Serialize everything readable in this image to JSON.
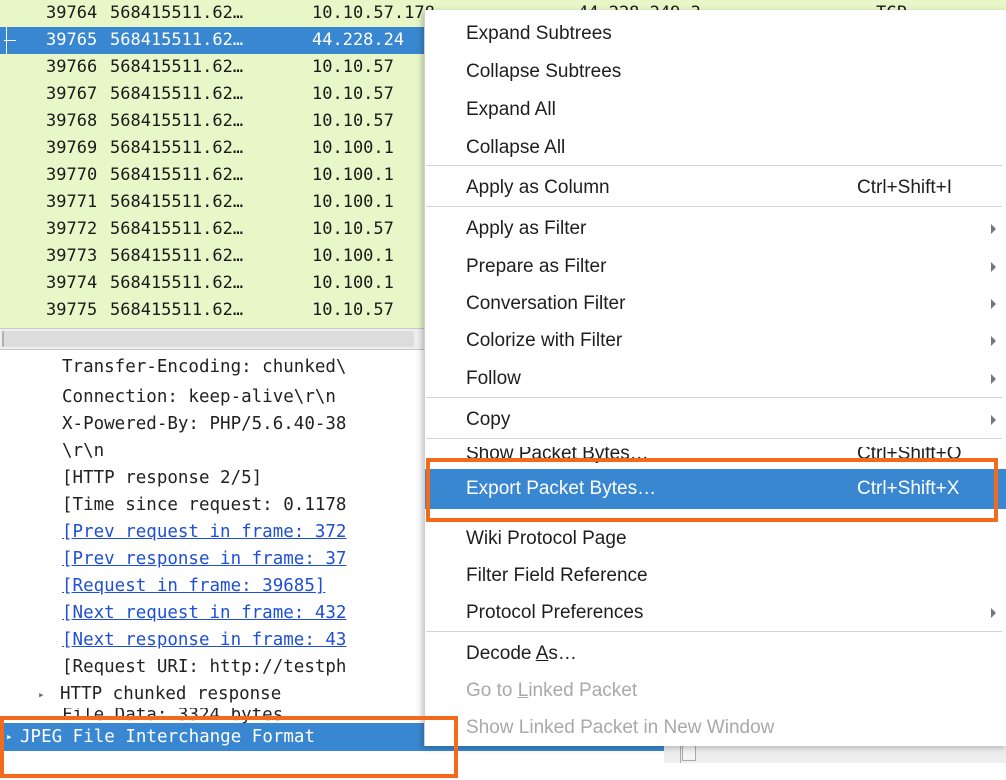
{
  "packet_list": {
    "rows": [
      {
        "no": "39764",
        "time": "568415511.62…",
        "src": "10.10.57.178",
        "dst": "44.228.249.3",
        "proto": "TCP",
        "selected": false
      },
      {
        "no": "39765",
        "time": "568415511.62…",
        "src": "44.228.24",
        "dst": "",
        "proto": "",
        "selected": true
      },
      {
        "no": "39766",
        "time": "568415511.62…",
        "src": "10.10.57",
        "dst": "",
        "proto": "",
        "selected": false
      },
      {
        "no": "39767",
        "time": "568415511.62…",
        "src": "10.10.57",
        "dst": "",
        "proto": "",
        "selected": false
      },
      {
        "no": "39768",
        "time": "568415511.62…",
        "src": "10.10.57",
        "dst": "",
        "proto": "",
        "selected": false
      },
      {
        "no": "39769",
        "time": "568415511.62…",
        "src": "10.100.1",
        "dst": "",
        "proto": "",
        "selected": false
      },
      {
        "no": "39770",
        "time": "568415511.62…",
        "src": "10.100.1",
        "dst": "",
        "proto": "",
        "selected": false
      },
      {
        "no": "39771",
        "time": "568415511.62…",
        "src": "10.100.1",
        "dst": "",
        "proto": "",
        "selected": false
      },
      {
        "no": "39772",
        "time": "568415511.62…",
        "src": "10.10.57",
        "dst": "",
        "proto": "",
        "selected": false
      },
      {
        "no": "39773",
        "time": "568415511.62…",
        "src": "10.100.1",
        "dst": "",
        "proto": "",
        "selected": false
      },
      {
        "no": "39774",
        "time": "568415511.62…",
        "src": "10.100.1",
        "dst": "",
        "proto": "",
        "selected": false
      },
      {
        "no": "39775",
        "time": "568415511.62…",
        "src": "10.10.57",
        "dst": "",
        "proto": "",
        "selected": false
      }
    ]
  },
  "details": {
    "lines": [
      {
        "text": "Transfer-Encoding: chunked\\"
      },
      {
        "text": "Connection: keep-alive\\r\\n"
      },
      {
        "text": "X-Powered-By: PHP/5.6.40-38"
      },
      {
        "text": "\\r\\n"
      },
      {
        "text": "[HTTP response 2/5]"
      },
      {
        "text": "[Time since request: 0.1178"
      },
      {
        "text": "[Prev request in frame: 372"
      },
      {
        "text": "[Prev response in frame: 37"
      },
      {
        "text": "[Request in frame: 39685]"
      },
      {
        "text": "[Next request in frame: 432"
      },
      {
        "text": "[Next response in frame: 43"
      },
      {
        "text": "[Request URI: http://testph"
      },
      {
        "text": "HTTP chunked response"
      },
      {
        "text": "File Data: 3324 bytes"
      },
      {
        "text": "JPEG File Interchange Format"
      }
    ]
  },
  "context_menu": {
    "expand_subtrees": "Expand Subtrees",
    "collapse_subtrees": "Collapse Subtrees",
    "expand_all": "Expand All",
    "collapse_all": "Collapse All",
    "apply_as_column": "Apply as Column",
    "apply_as_column_shortcut": "Ctrl+Shift+I",
    "apply_as_filter": "Apply as Filter",
    "prepare_as_filter": "Prepare as Filter",
    "conversation_filter": "Conversation Filter",
    "colorize_with_filter": "Colorize with Filter",
    "follow": "Follow",
    "copy": "Copy",
    "show_packet_bytes": "Show Packet Bytes…",
    "show_packet_bytes_shortcut": "Ctrl+Shift+O",
    "export_packet_bytes": "Export Packet Bytes…",
    "export_packet_bytes_shortcut": "Ctrl+Shift+X",
    "wiki_protocol_page": "Wiki Protocol Page",
    "filter_field_reference": "Filter Field Reference",
    "protocol_preferences": "Protocol Preferences",
    "decode_as_pre": "Decode ",
    "decode_as_underline": "A",
    "decode_as_post": "s…",
    "go_to_linked_pre": "Go to ",
    "go_to_linked_underline": "L",
    "go_to_linked_post": "inked Packet",
    "show_linked_window": "Show Linked Packet in New Window"
  },
  "colors": {
    "packet_list_bg": "#e7f7c8",
    "selection": "#3a87d1",
    "link": "#1f4fd6",
    "annotation": "#f26a1b"
  }
}
